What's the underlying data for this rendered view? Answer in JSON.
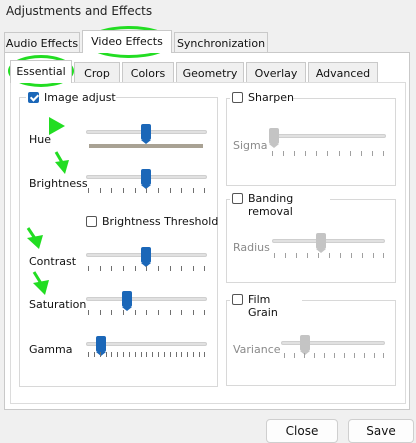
{
  "window": {
    "title": "Adjustments and Effects"
  },
  "tabs": [
    {
      "label": "Audio Effects"
    },
    {
      "label": "Video Effects"
    },
    {
      "label": "Synchronization"
    }
  ],
  "subtabs": [
    {
      "label": "Essential"
    },
    {
      "label": "Crop"
    },
    {
      "label": "Colors"
    },
    {
      "label": "Geometry"
    },
    {
      "label": "Overlay"
    },
    {
      "label": "Advanced"
    }
  ],
  "image_adjust": {
    "label": "Image adjust",
    "checked": true,
    "hue": {
      "label": "Hue",
      "level": 0.5
    },
    "brightness": {
      "label": "Brightness",
      "level": 0.5
    },
    "brightness_threshold": {
      "label": "Brightness Threshold",
      "checked": false
    },
    "contrast": {
      "label": "Contrast",
      "level": 0.5
    },
    "saturation": {
      "label": "Saturation",
      "level": 0.35
    },
    "gamma": {
      "label": "Gamma",
      "level": 0.1
    }
  },
  "sharpen": {
    "label": "Sharpen",
    "checked": false,
    "sigma_label": "Sigma",
    "level": 0.0
  },
  "banding": {
    "label": "Banding removal",
    "checked": false,
    "radius_label": "Radius",
    "level": 0.45
  },
  "film_grain": {
    "label": "Film Grain",
    "checked": false,
    "variance_label": "Variance",
    "level": 0.2
  },
  "buttons": {
    "close": "Close",
    "save": "Save"
  },
  "colors": {
    "accent": "#1b67b8",
    "annotation": "#22dd22"
  }
}
